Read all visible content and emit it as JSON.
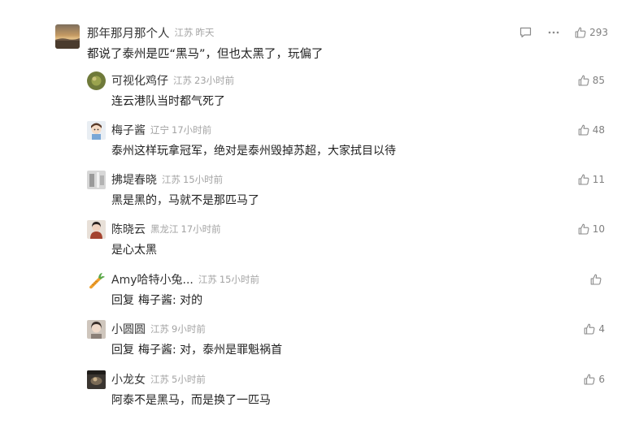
{
  "main_comment": {
    "username": "那年那月那个人",
    "location": "江苏",
    "time": "昨天",
    "text": "都说了泰州是匹“黑马”，但也太黑了，玩偏了",
    "likes": "293",
    "avatar_icon": "sunset-landscape-avatar",
    "reply_icon": "comment-icon",
    "more_icon": "more-dots-icon"
  },
  "replies": [
    {
      "username": "可视化鸡仔",
      "location": "江苏",
      "time": "23小时前",
      "text": "连云港队当时都气死了",
      "likes": "85",
      "avatar_icon": "avatar-green-circle"
    },
    {
      "username": "梅子酱",
      "location": "辽宁",
      "time": "17小时前",
      "text": "泰州这样玩拿冠军，绝对是泰州毁掉苏超，大家拭目以待",
      "likes": "48",
      "avatar_icon": "avatar-cartoon-girl"
    },
    {
      "username": "拂堤春晓",
      "location": "江苏",
      "time": "15小时前",
      "text": "黑是黑的，马就不是那匹马了",
      "likes": "11",
      "avatar_icon": "avatar-grey-figure"
    },
    {
      "username": "陈晓云",
      "location": "黑龙江",
      "time": "17小时前",
      "text": "是心太黑",
      "likes": "10",
      "avatar_icon": "avatar-portrait"
    },
    {
      "username": "Amy哈特小兔...",
      "location": "江苏",
      "time": "15小时前",
      "reply_prefix": "回复",
      "reply_target": "梅子酱",
      "reply_colon": ":",
      "text": " 对的",
      "likes": "",
      "avatar_icon": "avatar-carrot"
    },
    {
      "username": "小圆圆",
      "location": "江苏",
      "time": "9小时前",
      "reply_prefix": "回复",
      "reply_target": "梅子酱",
      "reply_colon": ":",
      "text": " 对，泰州是罪魁祸首",
      "likes": "4",
      "avatar_icon": "avatar-girl-photo"
    },
    {
      "username": "小龙女",
      "location": "江苏",
      "time": "5小时前",
      "text": "阿泰不是黑马，而是换了一匹马",
      "likes": "6",
      "avatar_icon": "avatar-dark-photo"
    }
  ],
  "like_icon": "thumbs-up-icon",
  "colors": {
    "text": "#222222",
    "meta": "#a3a3a3",
    "icon": "#8a8a8a"
  }
}
